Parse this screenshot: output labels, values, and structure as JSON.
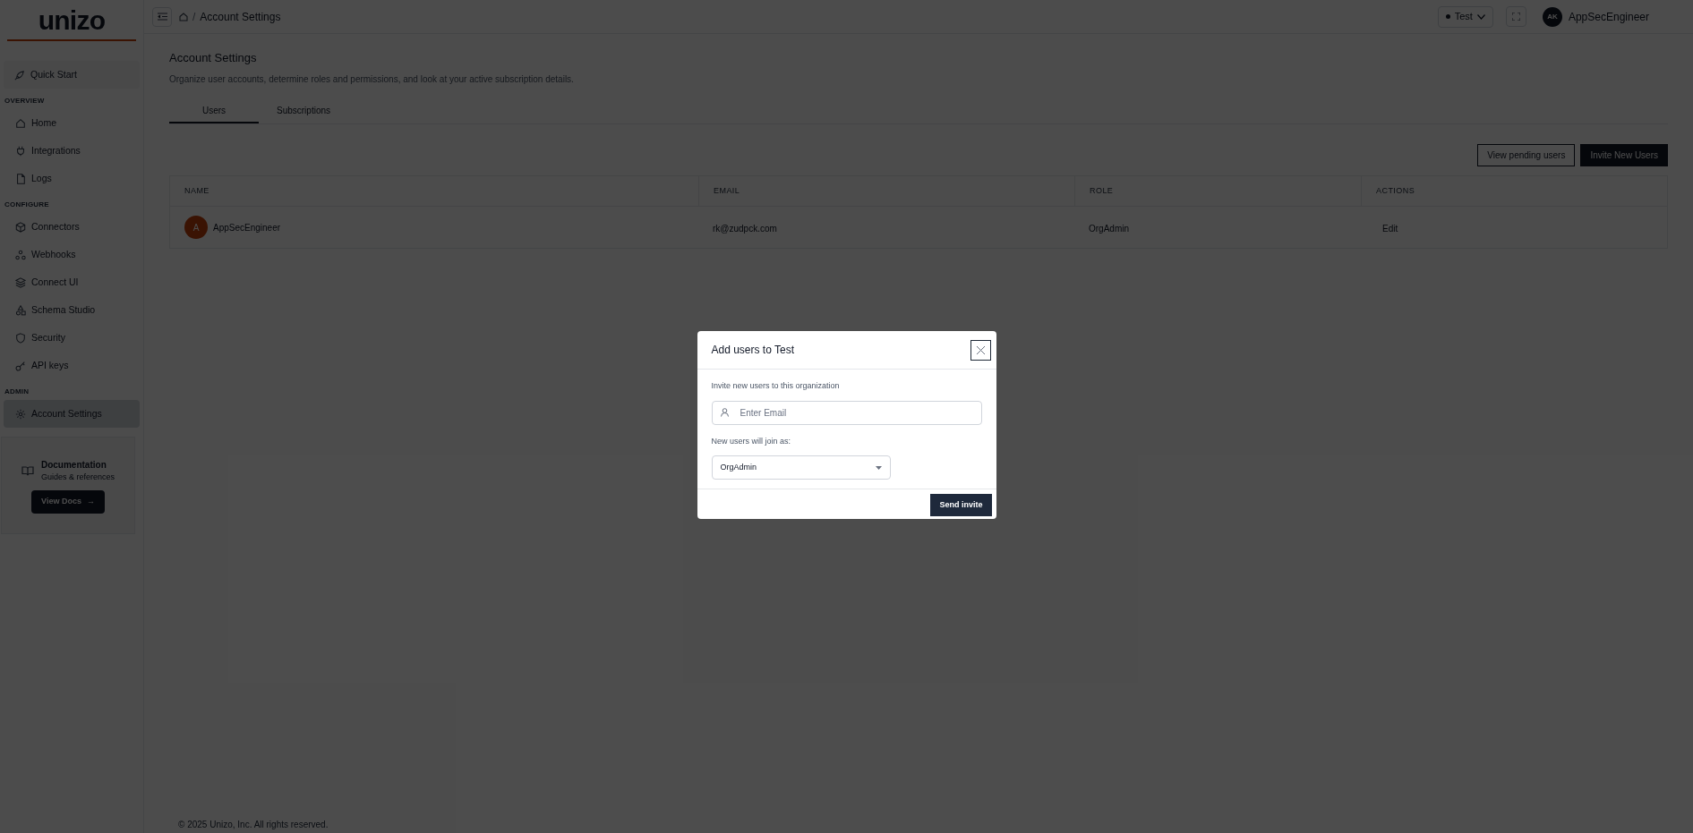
{
  "logo": "unizo",
  "sidebar": {
    "quick_start": {
      "label": "Quick Start"
    },
    "sections": [
      {
        "heading": "OVERVIEW",
        "items": [
          {
            "label": "Home",
            "selected": false
          },
          {
            "label": "Integrations",
            "selected": false
          },
          {
            "label": "Logs",
            "selected": false
          }
        ]
      },
      {
        "heading": "CONFIGURE",
        "items": [
          {
            "label": "Connectors",
            "selected": false
          },
          {
            "label": "Webhooks",
            "selected": false
          },
          {
            "label": "Connect UI",
            "selected": false
          },
          {
            "label": "Schema Studio",
            "selected": false
          },
          {
            "label": "Security",
            "selected": false
          },
          {
            "label": "API keys",
            "selected": false
          }
        ]
      },
      {
        "heading": "ADMIN",
        "items": [
          {
            "label": "Account Settings",
            "selected": true
          }
        ]
      }
    ]
  },
  "doc_card": {
    "title": "Documentation",
    "subtitle": "Guides & references",
    "button": "View Docs",
    "arrow": "→"
  },
  "top_bar": {
    "breadcrumb": "Account Settings",
    "separator": "/",
    "environment": "Test",
    "user_initials": "AK",
    "user_name": "AppSecEngineer"
  },
  "page": {
    "title": "Account Settings",
    "description": "Organize user accounts, determine roles and permissions, and look at your active subscription details.",
    "tabs": [
      {
        "label": "Users",
        "selected": true
      },
      {
        "label": "Subscriptions",
        "selected": false
      }
    ]
  },
  "actions": [
    {
      "label": "View pending users",
      "kind": "outline"
    },
    {
      "label": "Invite New Users",
      "kind": "primary"
    }
  ],
  "table": {
    "columns": [
      "NAME",
      "EMAIL",
      "ROLE",
      "ACTIONS"
    ],
    "rows": [
      {
        "initial": "A",
        "name": "AppSecEngineer",
        "email": "rk@zudpck.com",
        "role": "OrgAdmin",
        "action": "Edit"
      }
    ]
  },
  "footer": "© 2025 Unizo, Inc. All rights reserved.",
  "modal": {
    "title": "Add users to Test",
    "email_label": "Invite new users to this organization",
    "email_placeholder": "Enter Email",
    "role_label": "New users will join as:",
    "role_value": "OrgAdmin",
    "submit": "Send invite"
  }
}
